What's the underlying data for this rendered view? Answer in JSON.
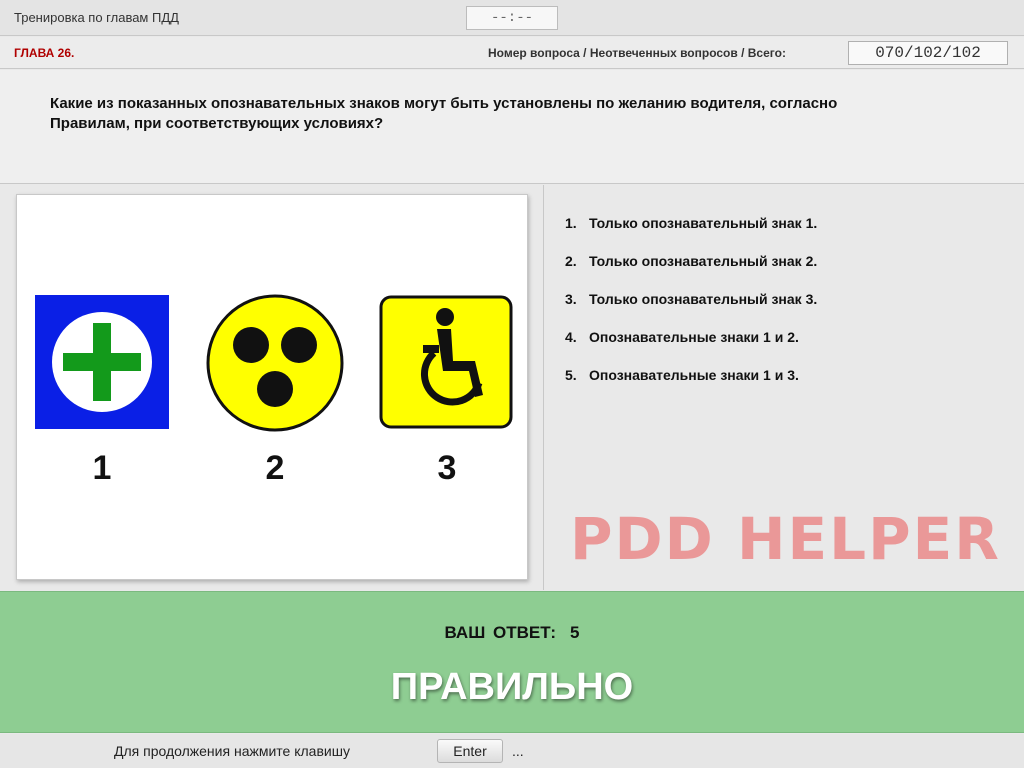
{
  "header": {
    "title": "Тренировка по главам ПДД",
    "timer": "--:--"
  },
  "chapter_bar": {
    "chapter": "ГЛАВА 26.",
    "counter_label": "Номер вопроса / Неотвеченных вопросов / Всего:",
    "counter_value": "070/102/102"
  },
  "question": {
    "text": "Какие из показанных опознавательных знаков могут быть установлены по желанию водителя, согласно Правилам, при соответствующих условиях?"
  },
  "image": {
    "signs": [
      {
        "label": "1",
        "icon": "first-aid-cross-icon",
        "color": "#0a1fe6"
      },
      {
        "label": "2",
        "icon": "deaf-driver-dots-icon",
        "color": "#ffff00"
      },
      {
        "label": "3",
        "icon": "disabled-driver-wheelchair-icon",
        "color": "#ffff00"
      }
    ]
  },
  "answers": [
    {
      "num": "1.",
      "text": "Только опознавательный знак 1."
    },
    {
      "num": "2.",
      "text": "Только опознавательный знак 2."
    },
    {
      "num": "3.",
      "text": "Только опознавательный знак 3."
    },
    {
      "num": "4.",
      "text": "Опознавательные знаки 1 и 2."
    },
    {
      "num": "5.",
      "text": "Опознавательные знаки 1 и 3."
    }
  ],
  "watermark": "PDD HELPER",
  "result": {
    "label": "ВАШ ОТВЕТ:",
    "value": "5",
    "verdict": "ПРАВИЛЬНО",
    "color": "#8ecd92"
  },
  "footer": {
    "text": "Для продолжения нажмите клавишу",
    "key": "Enter",
    "ellipsis": "..."
  }
}
